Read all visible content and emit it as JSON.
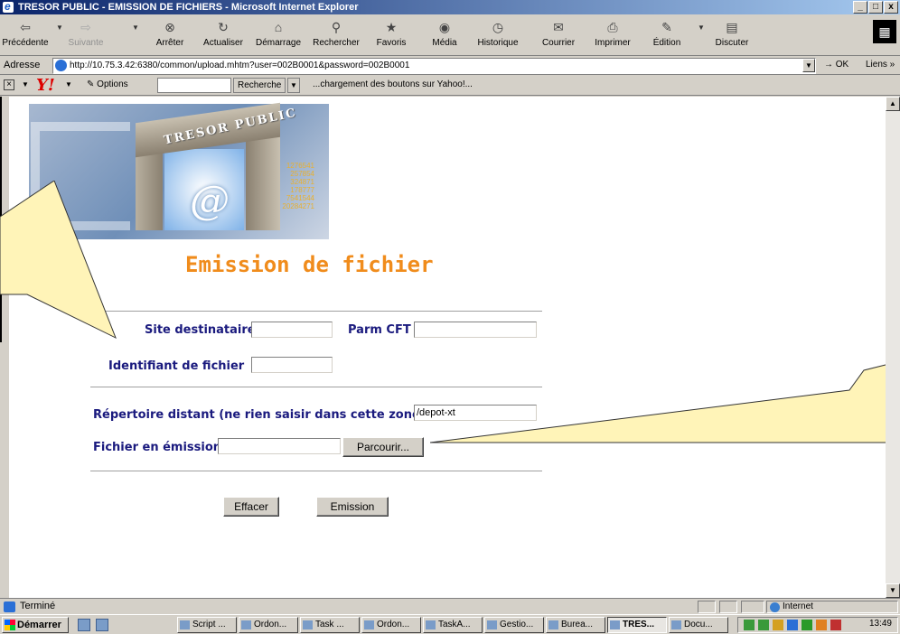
{
  "window": {
    "title": "TRESOR PUBLIC - EMISSION DE FICHIERS - Microsoft Internet Explorer",
    "minimize": "_",
    "maximize": "□",
    "close": "x"
  },
  "toolbar": {
    "back": "Précédente",
    "forward": "Suivante",
    "stop": "Arrêter",
    "refresh": "Actualiser",
    "home": "Démarrage",
    "search": "Rechercher",
    "favorites": "Favoris",
    "media": "Média",
    "history": "Historique",
    "mail": "Courrier",
    "print": "Imprimer",
    "edit": "Édition",
    "discuss": "Discuter"
  },
  "address": {
    "label": "Adresse",
    "url": "http://10.75.3.42:6380/common/upload.mhtm?user=002B0001&password=002B0001",
    "go": "OK",
    "links": "Liens"
  },
  "yahoo": {
    "options": "Options",
    "search_button": "Recherche",
    "status_message": "...chargement des boutons sur Yahoo!..."
  },
  "page": {
    "logo_text": "TRESOR PUBLIC",
    "logo_numbers": [
      "1276541",
      "257854",
      "324871",
      "178777",
      "7541544",
      "20284271"
    ],
    "title": "Emission de fichier",
    "form": {
      "site_label": "Site destinataire",
      "site_value": "",
      "parm_label": "Parm CFT",
      "parm_value": "",
      "file_id_label": "Identifiant de fichier",
      "file_id_value": "",
      "remote_dir_label": "Répertoire distant (ne rien saisir dans cette zone)",
      "remote_dir_value": "/depot-xt",
      "file_label": "Fichier en émission",
      "file_value": "",
      "browse_button": "Parcourir...",
      "clear_button": "Effacer",
      "submit_button": "Emission"
    }
  },
  "statusbar": {
    "status": "Terminé",
    "zone": "Internet"
  },
  "taskbar": {
    "start": "Démarrer",
    "tasks": [
      "Script ...",
      "Ordon...",
      "Task ...",
      "Ordon...",
      "TaskA...",
      "Gestio...",
      "Burea...",
      "TRES...",
      "Docu..."
    ],
    "clock": "13:49"
  },
  "colors": {
    "title_orange": "#f08c1c",
    "label_navy": "#1a1a7e",
    "callout_yellow": "#fff4b8",
    "titlebar_blue": "#0a246a"
  }
}
